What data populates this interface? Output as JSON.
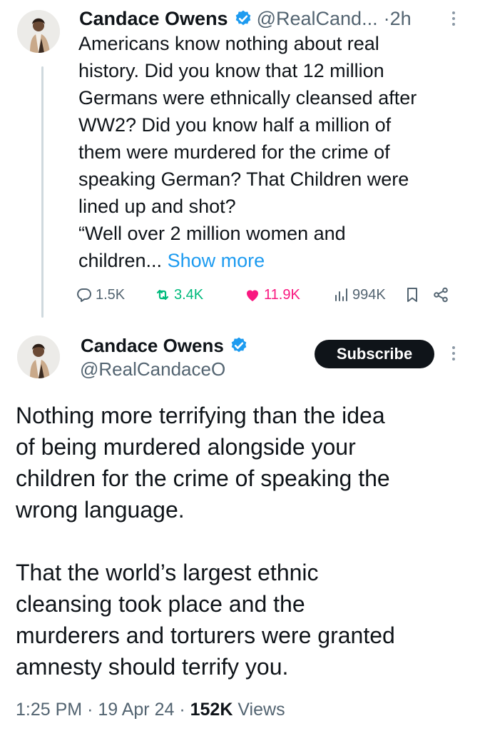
{
  "thread_tweet": {
    "author_name": "Candace Owens",
    "handle": "@RealCand...",
    "separator": "·",
    "time": "2h",
    "text_lines": [
      "Americans know nothing about real",
      "history. Did you know that 12 million",
      "Germans were ethnically cleansed after",
      "WW2? Did you know half a million of",
      "them were murdered for the crime of",
      "speaking German? That Children were",
      "lined up and shot?",
      "“Well over 2 million women and"
    ],
    "last_line_start": "children...",
    "show_more": "Show more",
    "replies": "1.5K",
    "reposts": "3.4K",
    "likes": "11.9K",
    "views": "994K",
    "icons": [
      "reply-icon",
      "repost-icon",
      "like-icon",
      "views-icon",
      "bookmark-icon",
      "share-icon",
      "more-icon",
      "verified-icon"
    ]
  },
  "main_tweet": {
    "author_name": "Candace Owens",
    "handle": "@RealCandaceO",
    "subscribe_label": "Subscribe",
    "paragraph1_lines": [
      "Nothing more terrifying than the idea",
      "of being murdered alongside your",
      "children for the crime of speaking the",
      "wrong language."
    ],
    "paragraph2_lines": [
      "That the world’s largest ethnic",
      "cleansing took place and the",
      "murderers and torturers were granted",
      "amnesty should terrify you."
    ],
    "time": "1:25 PM",
    "separator": "·",
    "date": "19 Apr 24",
    "view_count": "152K",
    "views_label": "Views"
  },
  "colors": {
    "text": "#0f1419",
    "muted": "#536471",
    "link": "#1d9bf0",
    "verified": "#1d9bf0",
    "repost": "#00ba7c",
    "like": "#f91880",
    "button_bg": "#0f1419"
  }
}
